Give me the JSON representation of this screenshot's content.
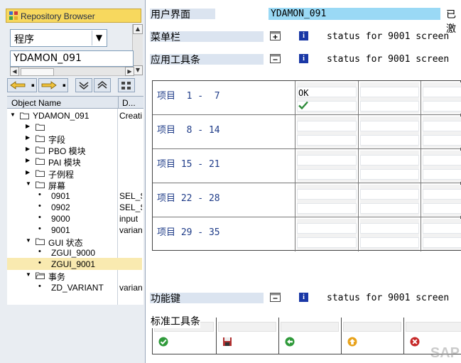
{
  "repository_browser": {
    "title": "Repository Browser",
    "object_type": "程序",
    "object_name": "YDAMON_091",
    "columns": {
      "name": "Object Name",
      "desc": "D..."
    },
    "tree": [
      {
        "label": "YDAMON_091",
        "desc": "Creati",
        "level": 0,
        "expanded": true,
        "type": "folder"
      },
      {
        "label": "",
        "desc": "",
        "level": 1,
        "expanded": false,
        "type": "folder"
      },
      {
        "label": "字段",
        "desc": "",
        "level": 1,
        "expanded": false,
        "type": "folder"
      },
      {
        "label": "PBO 模块",
        "desc": "",
        "level": 1,
        "expanded": false,
        "type": "folder"
      },
      {
        "label": "PAI 模块",
        "desc": "",
        "level": 1,
        "expanded": false,
        "type": "folder"
      },
      {
        "label": "子例程",
        "desc": "",
        "level": 1,
        "expanded": false,
        "type": "folder"
      },
      {
        "label": "屏幕",
        "desc": "",
        "level": 1,
        "expanded": true,
        "type": "folder"
      },
      {
        "label": "0901",
        "desc": "SEL_S",
        "level": 2,
        "type": "item"
      },
      {
        "label": "0902",
        "desc": "SEL_S",
        "level": 2,
        "type": "item"
      },
      {
        "label": "9000",
        "desc": "input",
        "level": 2,
        "type": "item"
      },
      {
        "label": "9001",
        "desc": "variant",
        "level": 2,
        "type": "item"
      },
      {
        "label": "GUI 状态",
        "desc": "",
        "level": 1,
        "expanded": true,
        "type": "folder"
      },
      {
        "label": "ZGUI_9000",
        "desc": "",
        "level": 2,
        "type": "item"
      },
      {
        "label": "ZGUI_9001",
        "desc": "",
        "level": 2,
        "type": "item",
        "selected": true
      },
      {
        "label": "事务",
        "desc": "",
        "level": 1,
        "expanded": true,
        "type": "folder-open"
      },
      {
        "label": "ZD_VARIANT",
        "desc": "variant",
        "level": 2,
        "type": "item"
      }
    ]
  },
  "status_editor": {
    "ui_label": "用户界面",
    "ui_value": "YDAMON_091",
    "ui_state": "已激",
    "menu_bar": {
      "label": "菜单栏",
      "text": "status for 9001 screen"
    },
    "app_toolbar": {
      "label": "应用工具条",
      "text": "status for 9001 screen"
    },
    "items": [
      {
        "label": "项目  1 -  7",
        "first_value": "OK"
      },
      {
        "label": "项目  8 - 14"
      },
      {
        "label": "项目 15 - 21"
      },
      {
        "label": "项目 22 - 28"
      },
      {
        "label": "项目 29 - 35"
      }
    ],
    "function_keys": {
      "label": "功能键",
      "text": "status for 9001 screen"
    },
    "std_toolbar": {
      "label": "标准工具条",
      "icons": [
        "check-icon",
        "save-icon",
        "back-icon",
        "exit-icon",
        "cancel-icon"
      ]
    }
  },
  "watermark": "SAP",
  "colors": {
    "header_yellow": "#f7d85e",
    "label_bar": "#dbe4f0",
    "value_cyan": "#9ad9f5",
    "selected_row": "#f9eab0"
  }
}
